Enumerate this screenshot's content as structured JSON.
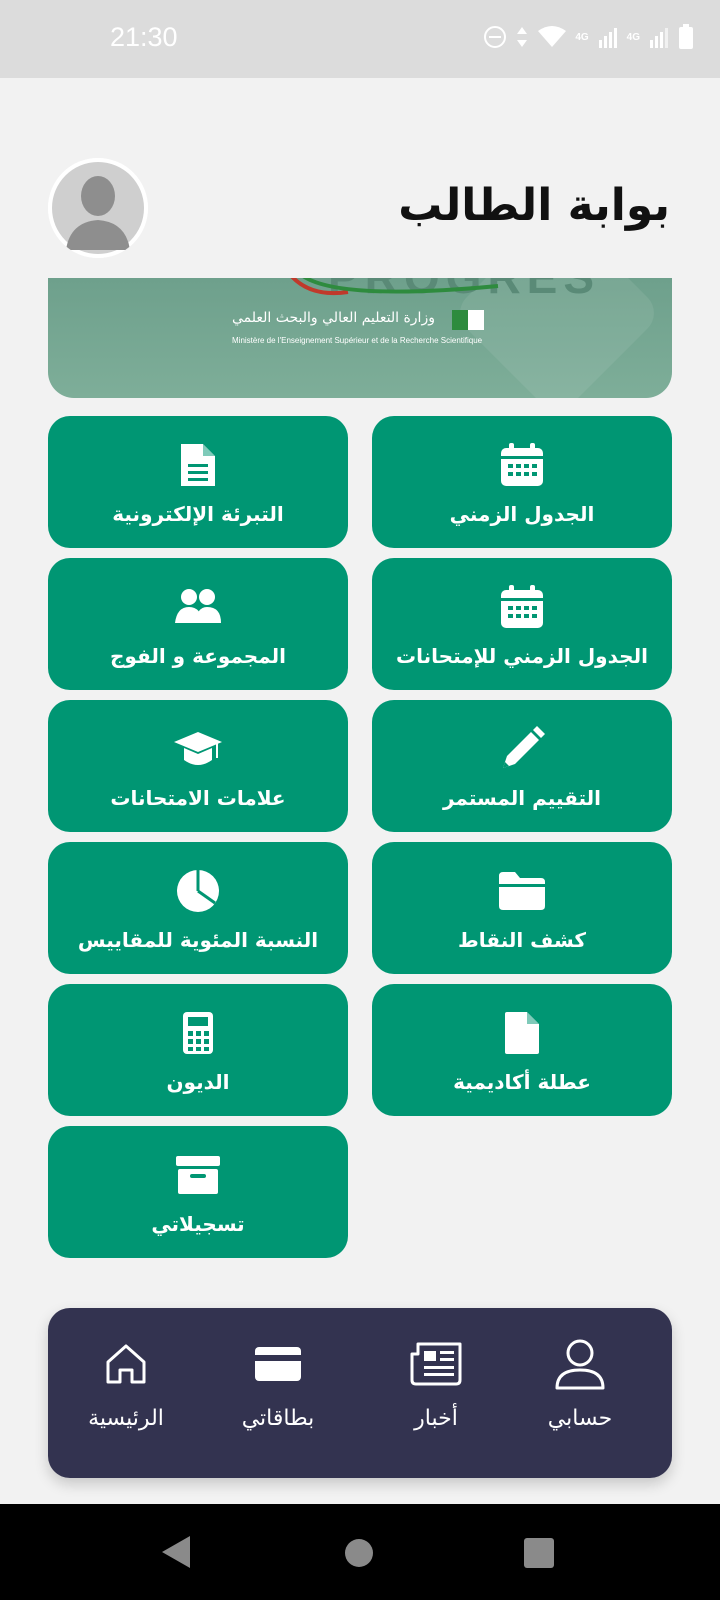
{
  "status": {
    "time": "21:30",
    "network_1": "4G",
    "network_2": "4G"
  },
  "header": {
    "title": "بوابة الطالب"
  },
  "banner": {
    "logo_text": "PROGRES",
    "ministry_ar": "وزارة التعليم العالي والبحث العلمي",
    "ministry_fr": "Ministère de l'Enseignement Supérieur et de la Recherche Scientifique"
  },
  "tiles": [
    {
      "label": "الجدول الزمني",
      "icon": "calendar-icon"
    },
    {
      "label": "التبرئة الإلكترونية",
      "icon": "document-icon"
    },
    {
      "label": "الجدول الزمني للإمتحانات",
      "icon": "calendar-icon"
    },
    {
      "label": "المجموعة و الفوج",
      "icon": "users-icon"
    },
    {
      "label": "التقييم المستمر",
      "icon": "pencil-icon"
    },
    {
      "label": "علامات الامتحانات",
      "icon": "graduation-cap-icon"
    },
    {
      "label": "كشف النقاط",
      "icon": "folder-icon"
    },
    {
      "label": "النسبة المئوية للمقاييس",
      "icon": "pie-chart-icon"
    },
    {
      "label": "عطلة أكاديمية",
      "icon": "file-icon"
    },
    {
      "label": "الديون",
      "icon": "calculator-icon"
    },
    {
      "label": "تسجيلاتي",
      "icon": "inbox-icon"
    }
  ],
  "bottom_nav": [
    {
      "label": "حسابي",
      "icon": "user-icon"
    },
    {
      "label": "أخبار",
      "icon": "newspaper-icon"
    },
    {
      "label": "بطاقاتي",
      "icon": "card-icon"
    },
    {
      "label": "الرئيسية",
      "icon": "home-icon"
    }
  ],
  "colors": {
    "tile": "#009673",
    "nav": "#333350",
    "background": "#f2f2f2"
  }
}
